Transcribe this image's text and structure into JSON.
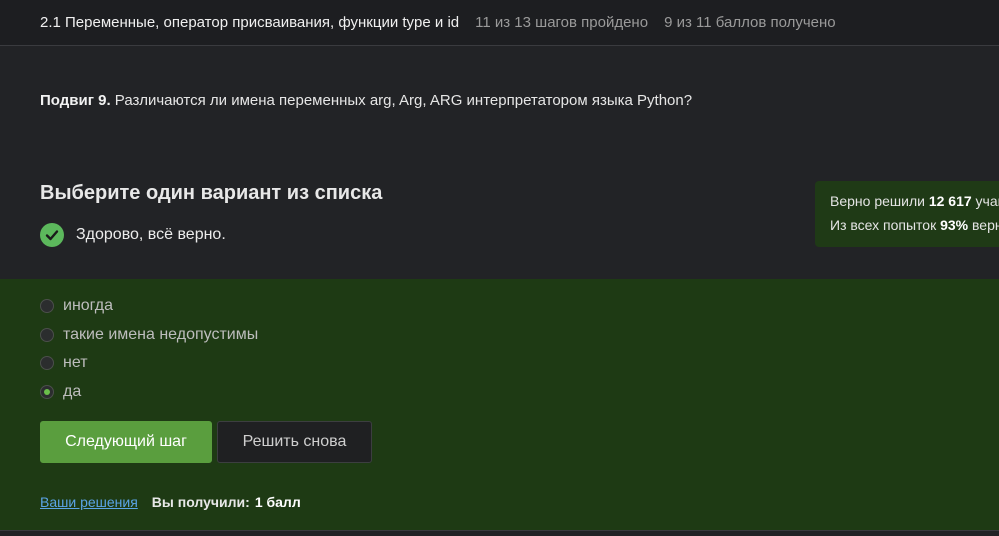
{
  "topbar": {
    "lesson_title": "2.1 Переменные, оператор присваивания, функции type и id",
    "steps_progress": "11 из 13 шагов пройдено",
    "points_progress": "9 из 11 баллов  получено"
  },
  "question": {
    "label": "Подвиг 9.",
    "text": " Различаются ли имена переменных arg, Arg, ARG интерпретатором языка Python?"
  },
  "choose_title": "Выберите один вариант из списка",
  "feedback": {
    "text": "Здорово, всё верно.",
    "icon": "check-circle-icon",
    "color": "#5cb85c"
  },
  "stats": {
    "solved_prefix": "Верно решили ",
    "solved_count": "12 617",
    "solved_suffix": " учащихся",
    "attempts_prefix": "Из всех попыток ",
    "attempts_percent": "93%",
    "attempts_suffix": " верных"
  },
  "options": [
    {
      "label": "иногда",
      "selected": false
    },
    {
      "label": "такие имена недопустимы",
      "selected": false
    },
    {
      "label": "нет",
      "selected": false
    },
    {
      "label": "да",
      "selected": true
    }
  ],
  "buttons": {
    "next_label": "Следующий шаг",
    "retry_label": "Решить снова"
  },
  "footer": {
    "solutions_link": "Ваши решения",
    "result_label": "Вы получили:",
    "result_value": "1 балл"
  },
  "colors": {
    "background": "#222326",
    "answer_area": "#1e3a14",
    "accent_green": "#5a9e3e",
    "link_blue": "#5ba4e6"
  }
}
